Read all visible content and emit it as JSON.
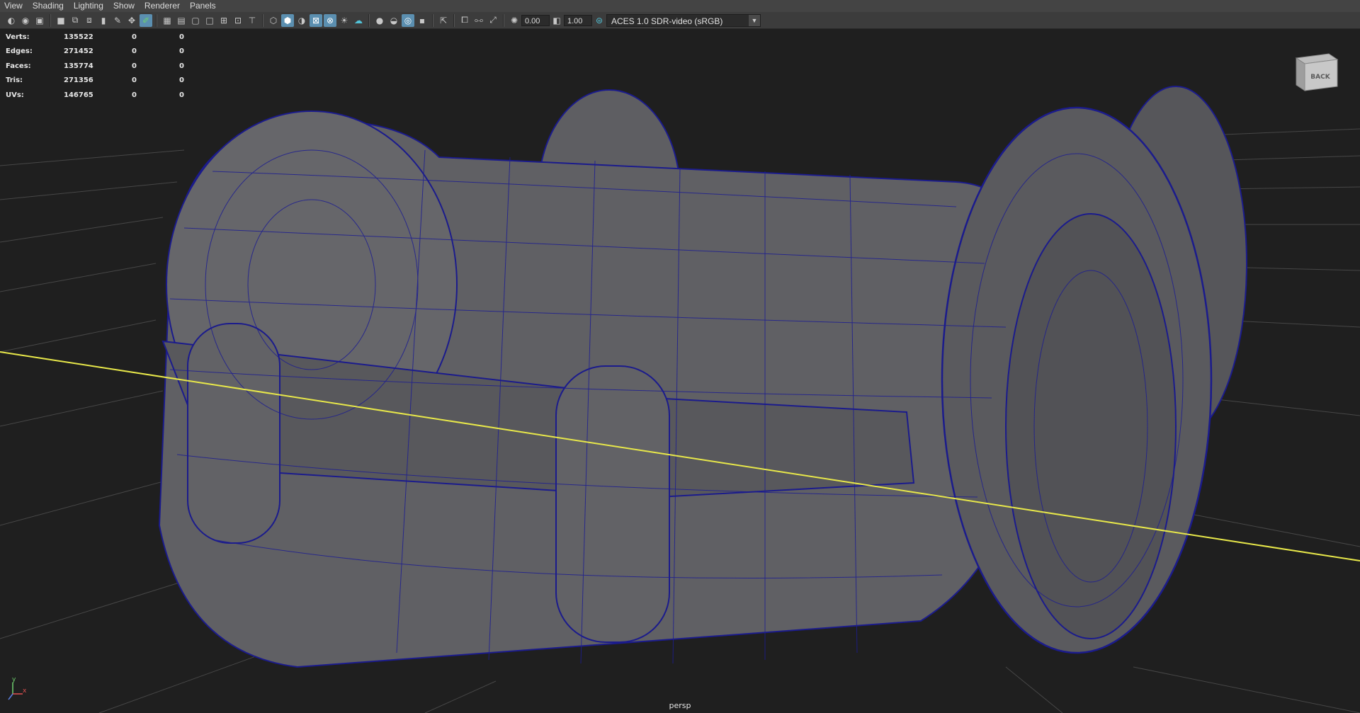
{
  "menu": [
    "View",
    "Shading",
    "Lighting",
    "Show",
    "Renderer",
    "Panels"
  ],
  "toolbar": {
    "exposure_value": "0.00",
    "gamma_value": "1.00",
    "color_space": "ACES 1.0 SDR-video (sRGB)"
  },
  "hud": {
    "rows": [
      {
        "label": "Verts:",
        "v1": "135522",
        "v2": "0",
        "v3": "0"
      },
      {
        "label": "Edges:",
        "v1": "271452",
        "v2": "0",
        "v3": "0"
      },
      {
        "label": "Faces:",
        "v1": "135774",
        "v2": "0",
        "v3": "0"
      },
      {
        "label": "Tris:",
        "v1": "271356",
        "v2": "0",
        "v3": "0"
      },
      {
        "label": "UVs:",
        "v1": "146765",
        "v2": "0",
        "v3": "0"
      }
    ]
  },
  "viewcube": {
    "face": "BACK"
  },
  "camera": {
    "name": "persp"
  },
  "axis": {
    "y": "y",
    "x": "x"
  },
  "colors": {
    "background": "#1f1f1f",
    "mesh_fill": "#5c5c60",
    "wireframe": "#1b1b8c",
    "grid": "#4a4a4a",
    "axis_line": "#e8e84a"
  }
}
